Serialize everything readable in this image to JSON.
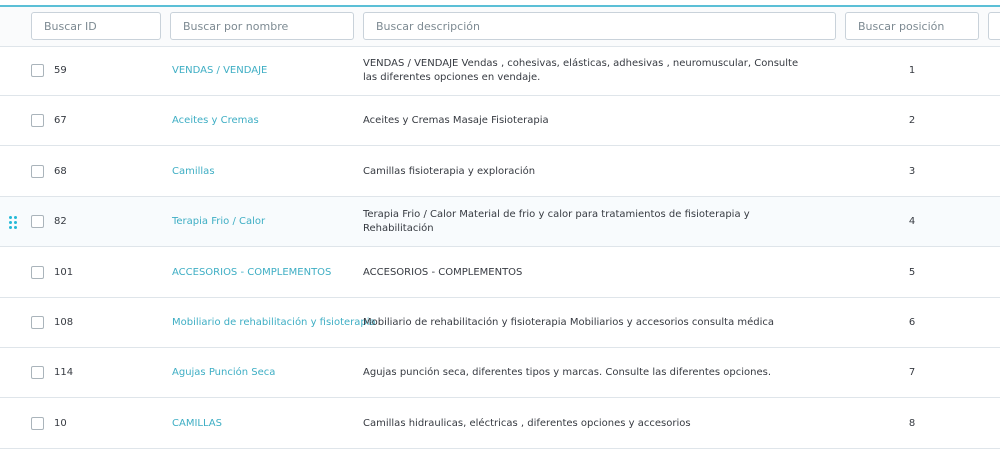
{
  "filters": {
    "id": "Buscar ID",
    "name": "Buscar por nombre",
    "description": "Buscar descripción",
    "position": "Buscar posición"
  },
  "rows": [
    {
      "id": "59",
      "name": "VENDAS / VENDAJE",
      "description": "VENDAS / VENDAJE Vendas , cohesivas, elásticas, adhesivas , neuromuscular, Consulte las diferentes opciones en vendaje.",
      "position": "1"
    },
    {
      "id": "67",
      "name": "Aceites y Cremas",
      "description": "Aceites y Cremas Masaje Fisioterapia",
      "position": "2"
    },
    {
      "id": "68",
      "name": "Camillas",
      "description": "Camillas fisioterapia y exploración",
      "position": "3"
    },
    {
      "id": "82",
      "name": "Terapia Frio / Calor",
      "description": "Terapia Frio / Calor Material de frio y calor para tratamientos de fisioterapia y Rehabilitación",
      "position": "4"
    },
    {
      "id": "101",
      "name": "ACCESORIOS - COMPLEMENTOS",
      "description": "ACCESORIOS - COMPLEMENTOS",
      "position": "5"
    },
    {
      "id": "108",
      "name": "Mobiliario de rehabilitación y fisioterapia",
      "description": "Mobiliario de rehabilitación y fisioterapia Mobiliarios y accesorios consulta médica",
      "position": "6"
    },
    {
      "id": "114",
      "name": "Agujas Punción Seca",
      "description": "Agujas punción seca, diferentes tipos y marcas. Consulte las diferentes opciones.",
      "position": "7"
    },
    {
      "id": "10",
      "name": "CAMILLAS",
      "description": "Camillas hidraulicas, eléctricas , diferentes opciones y accesorios",
      "position": "8"
    }
  ]
}
